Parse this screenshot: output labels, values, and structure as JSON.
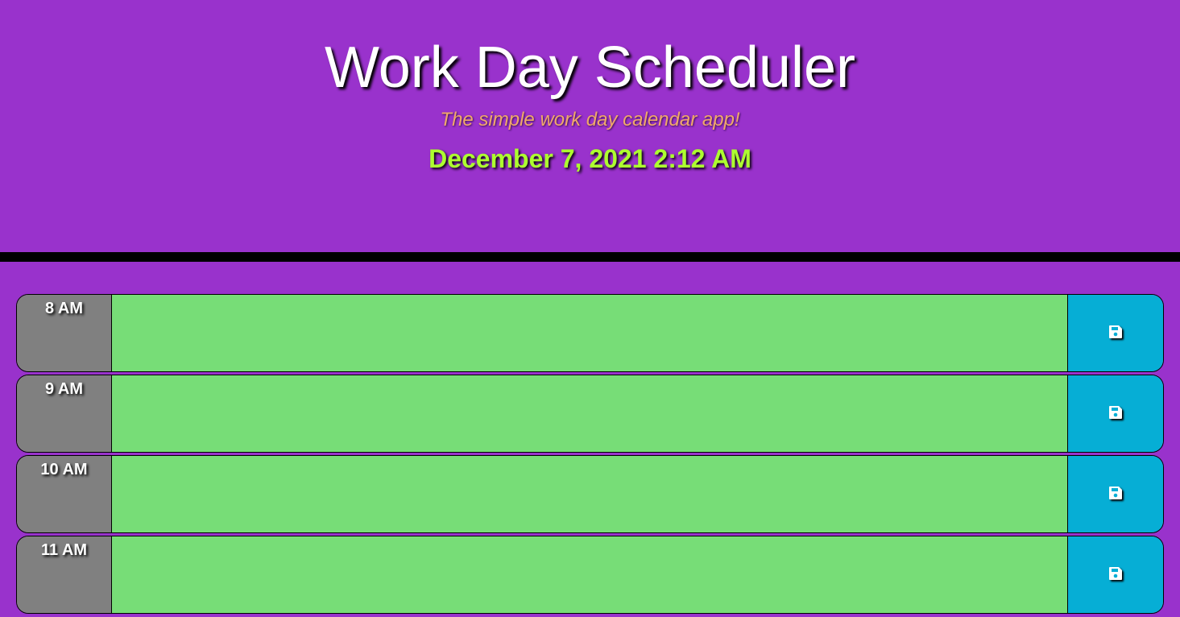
{
  "header": {
    "title": "Work Day Scheduler",
    "subtitle": "The simple work day calendar app!",
    "current_day": "December 7, 2021 2:12 AM"
  },
  "colors": {
    "background": "#9932cc",
    "future_block": "#77dd77",
    "hour_column": "#808080",
    "save_button": "#06aed5",
    "date_text": "#adff2f",
    "subtitle_text": "#f0a86a"
  },
  "time_blocks": [
    {
      "hour": "8 AM",
      "description": "",
      "save_icon": "save-icon"
    },
    {
      "hour": "9 AM",
      "description": "",
      "save_icon": "save-icon"
    },
    {
      "hour": "10 AM",
      "description": "",
      "save_icon": "save-icon"
    },
    {
      "hour": "11 AM",
      "description": "",
      "save_icon": "save-icon"
    }
  ]
}
